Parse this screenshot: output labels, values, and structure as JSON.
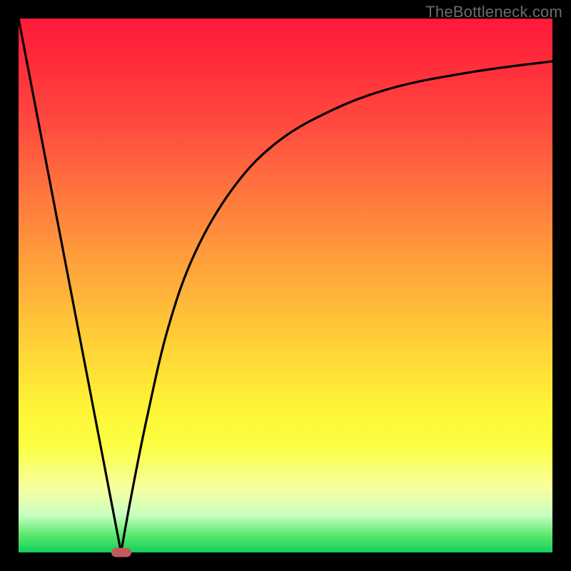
{
  "watermark": "TheBottleneck.com",
  "colors": {
    "frame": "#000000",
    "curve": "#000000",
    "marker": "#c35a5a"
  },
  "chart_data": {
    "type": "line",
    "title": "",
    "xlabel": "",
    "ylabel": "",
    "xlim": [
      0,
      100
    ],
    "ylim": [
      0,
      100
    ],
    "grid": false,
    "legend": false,
    "series": [
      {
        "name": "left-branch",
        "x": [
          0,
          19.2
        ],
        "y": [
          100,
          0
        ]
      },
      {
        "name": "right-curve",
        "x": [
          19.2,
          21,
          24,
          28,
          33,
          40,
          48,
          58,
          70,
          85,
          100
        ],
        "y": [
          0,
          10,
          25,
          42,
          56,
          68,
          76.5,
          82.5,
          87,
          90,
          92
        ]
      }
    ],
    "annotations": [
      {
        "name": "minimum-marker",
        "x": 19.2,
        "y": 0,
        "shape": "pill"
      }
    ],
    "background_gradient": {
      "direction": "top-to-bottom",
      "stops": [
        {
          "pos": 0.0,
          "color": "#ff1a3a"
        },
        {
          "pos": 0.34,
          "color": "#ff7a3d"
        },
        {
          "pos": 0.62,
          "color": "#ffd437"
        },
        {
          "pos": 0.8,
          "color": "#fbff41"
        },
        {
          "pos": 0.93,
          "color": "#c8ffc1"
        },
        {
          "pos": 1.0,
          "color": "#12cf5d"
        }
      ]
    }
  }
}
